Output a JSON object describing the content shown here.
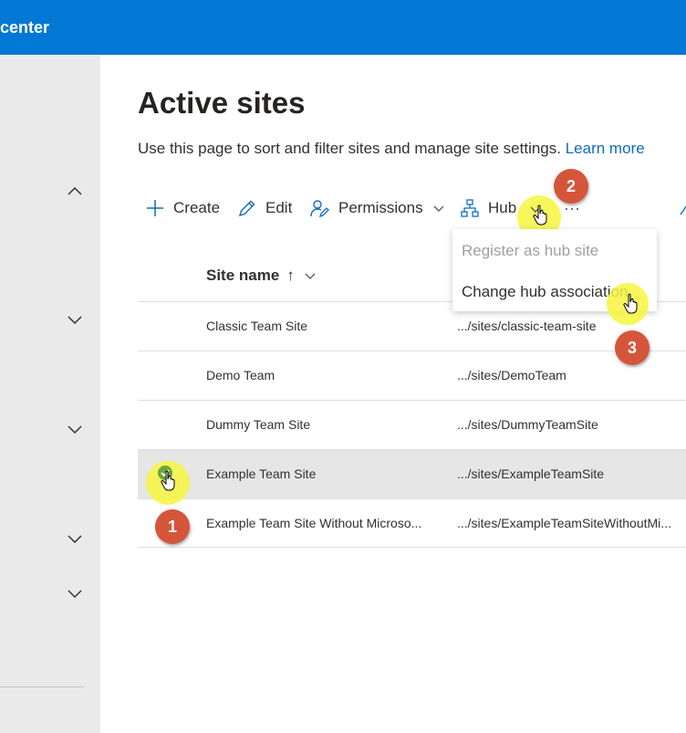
{
  "topbar": {
    "title": "center"
  },
  "page": {
    "title": "Active sites",
    "description": "Use this page to sort and filter sites and manage site settings.",
    "learn_more": "Learn more"
  },
  "commands": {
    "create": "Create",
    "edit": "Edit",
    "permissions": "Permissions",
    "hub": "Hub",
    "more": "···"
  },
  "table": {
    "column_site_name": "Site name",
    "sort_arrow": "↑",
    "rows": [
      {
        "name": "Classic Team Site",
        "url": ".../sites/classic-team-site"
      },
      {
        "name": "Demo Team",
        "url": ".../sites/DemoTeam"
      },
      {
        "name": "Dummy Team Site",
        "url": ".../sites/DummyTeamSite"
      },
      {
        "name": "Example Team Site",
        "url": ".../sites/ExampleTeamSite"
      },
      {
        "name": "Example Team Site Without Microso...",
        "url": ".../sites/ExampleTeamSiteWithoutMi..."
      }
    ]
  },
  "hub_menu": {
    "register": "Register as hub site",
    "change": "Change hub association"
  },
  "callouts": {
    "one": "1",
    "two": "2",
    "three": "3"
  },
  "colors": {
    "brand": "#0078d4",
    "badge": "#d5553a",
    "highlight": "#f6f640",
    "link": "#0f6cbd"
  }
}
